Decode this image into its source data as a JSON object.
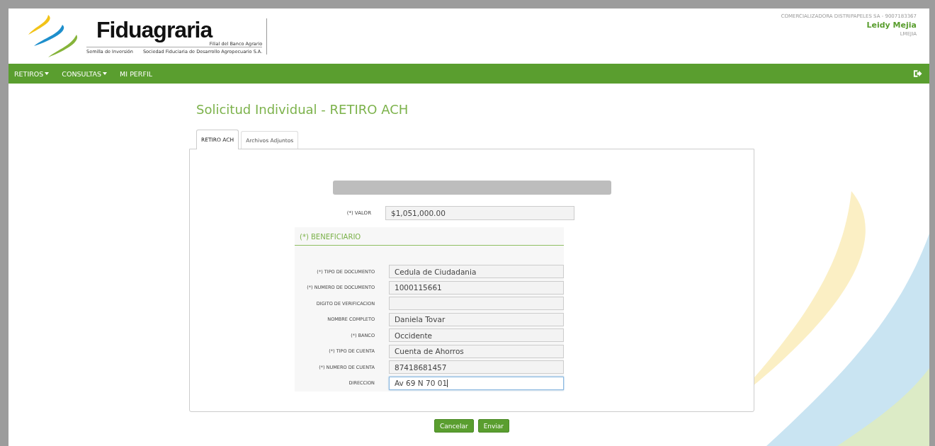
{
  "header": {
    "brand": "Fiduagraria",
    "brand_sub": "Filial del Banco Agrario",
    "slogan": "Semilla de Inversión",
    "company": "Sociedad Fiduciaria de Desarrollo Agropecuario S.A.",
    "account": "COMERCIALIZADORA DISTRIPAPELES SA - 9007183367",
    "user_name": "Leidy Mejia",
    "user_login": "LMEJIA"
  },
  "nav": [
    {
      "label": "RETIROS",
      "dropdown": true
    },
    {
      "label": "CONSULTAS",
      "dropdown": true
    },
    {
      "label": "MI PERFIL",
      "dropdown": false
    }
  ],
  "title": "Solicitud Individual - RETIRO ACH",
  "tabs": [
    {
      "label": "RETIRO ACH",
      "selected": true
    },
    {
      "label": "Archivos Adjuntos",
      "selected": false
    }
  ],
  "valor": {
    "label": "(*) VALOR",
    "value": "$1,051,000.00"
  },
  "beneficiario": {
    "title": "(*) BENEFICIARIO",
    "fields": [
      {
        "label": "(*) TIPO DE DOCUMENTO",
        "value": "Cedula de Ciudadania",
        "focused": false
      },
      {
        "label": "(*) NUMERO DE DOCUMENTO",
        "value": "1000115661",
        "focused": false
      },
      {
        "label": "DIGITO DE VERIFICACION",
        "focused": false
      },
      {
        "label": "NOMBRE COMPLETO",
        "value": "Daniela Tovar",
        "focused": false
      },
      {
        "label": "(*) BANCO",
        "value": "Occidente",
        "focused": false
      },
      {
        "label": "(*) TIPO DE CUENTA",
        "value": "Cuenta de Ahorros",
        "focused": false
      },
      {
        "label": "(*) NUMERO DE CUENTA",
        "value": "87418681457",
        "focused": false
      },
      {
        "label": "DIRECCION",
        "value": "Av 69 N 70 01",
        "focused": true
      }
    ]
  },
  "buttons": [
    "Cancelar",
    "Enviar"
  ]
}
